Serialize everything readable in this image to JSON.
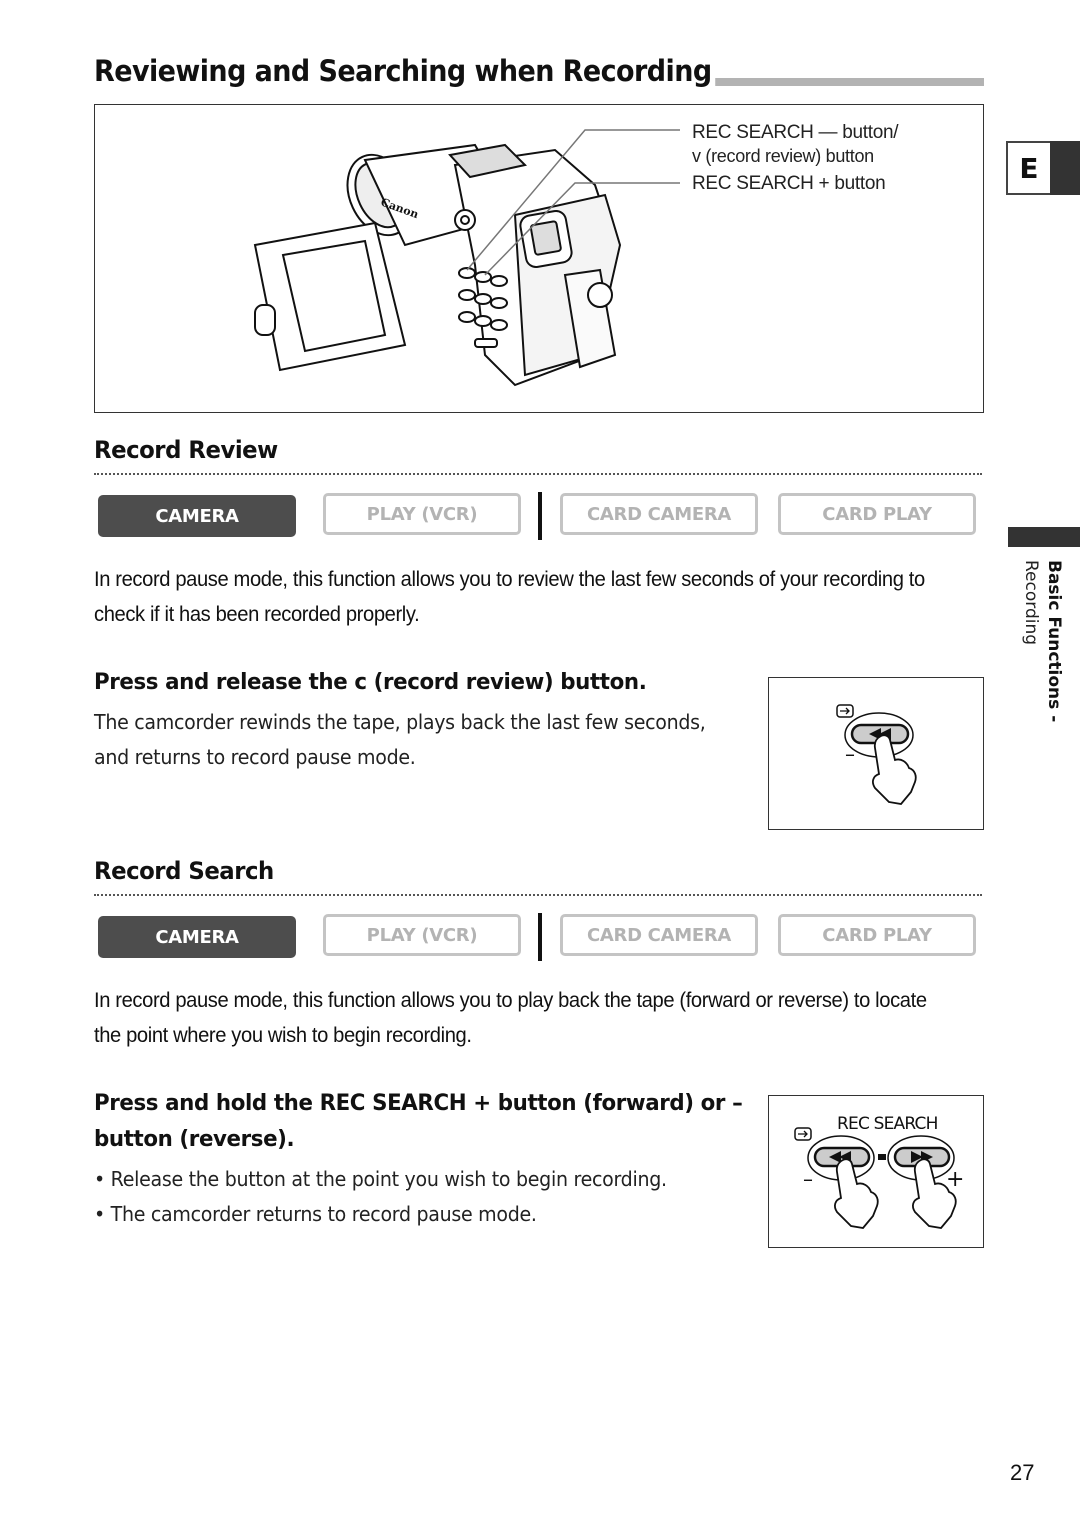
{
  "page": {
    "title": "Reviewing and Searching when Recording",
    "language_tab": "E",
    "side_tab": {
      "section": "Basic Functions -",
      "subsection": "Recording"
    },
    "page_number": "27"
  },
  "figure": {
    "callouts": [
      "REC SEARCH — button/",
      "v   (record review) button",
      "REC SEARCH + button"
    ],
    "brand_label": "Canon"
  },
  "modes": [
    "CAMERA",
    "PLAY (VCR)",
    "CARD CAMERA",
    "CARD PLAY"
  ],
  "record_review": {
    "heading": "Record Review",
    "active_mode": "CAMERA",
    "intro": "In record pause mode, this function allows you to review the last few seconds of your recording to check if it has been recorded properly.",
    "step_heading": "Press and release the c   (record review) button.",
    "step_body": "The camcorder rewinds the tape, plays back the last few seconds, and returns to record pause mode.",
    "illustration": {
      "minus_label": "–"
    }
  },
  "record_search": {
    "heading": "Record Search",
    "active_mode": "CAMERA",
    "intro": "In record pause mode, this function allows you to play back the tape (forward or reverse) to locate the point where you wish to begin recording.",
    "step_heading_line1": "Press and hold the REC SEARCH + button (forward) or –",
    "step_heading_line2": "button (reverse).",
    "bullets": [
      "Release the button at the point you wish to begin recording.",
      "The camcorder returns to record pause mode."
    ],
    "illustration": {
      "label": "REC SEARCH",
      "minus_label": "–",
      "plus_label": "+"
    }
  }
}
